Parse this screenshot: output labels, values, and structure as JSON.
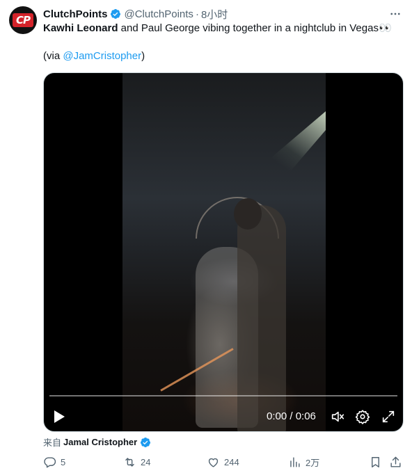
{
  "tweet": {
    "author_name": "ClutchPoints",
    "author_handle": "@ClutchPoints",
    "separator": "·",
    "time": "8小时",
    "avatar_logo": "CP",
    "text_bold": "Kawhi Leonard",
    "text_rest": " and Paul George vibing together in a nightclub in Vegas",
    "emoji": "👀",
    "via_prefix": "(via ",
    "via_handle": "@JamCristopher",
    "via_suffix": ")"
  },
  "video": {
    "timecode": "0:00 / 0:06",
    "progress": 0
  },
  "source": {
    "from_label": "来自",
    "author": "Jamal Cristopher"
  },
  "actions": {
    "replies": "5",
    "retweets": "24",
    "likes": "244",
    "views": "2万"
  },
  "colors": {
    "accent": "#1d9bf0",
    "secondary_text": "#536471",
    "brand_red": "#d4232a"
  },
  "icons": [
    "verified-badge-icon",
    "more-icon",
    "play-icon",
    "mute-icon",
    "settings-icon",
    "fullscreen-icon",
    "reply-icon",
    "retweet-icon",
    "like-icon",
    "views-icon",
    "bookmark-icon",
    "share-icon"
  ]
}
